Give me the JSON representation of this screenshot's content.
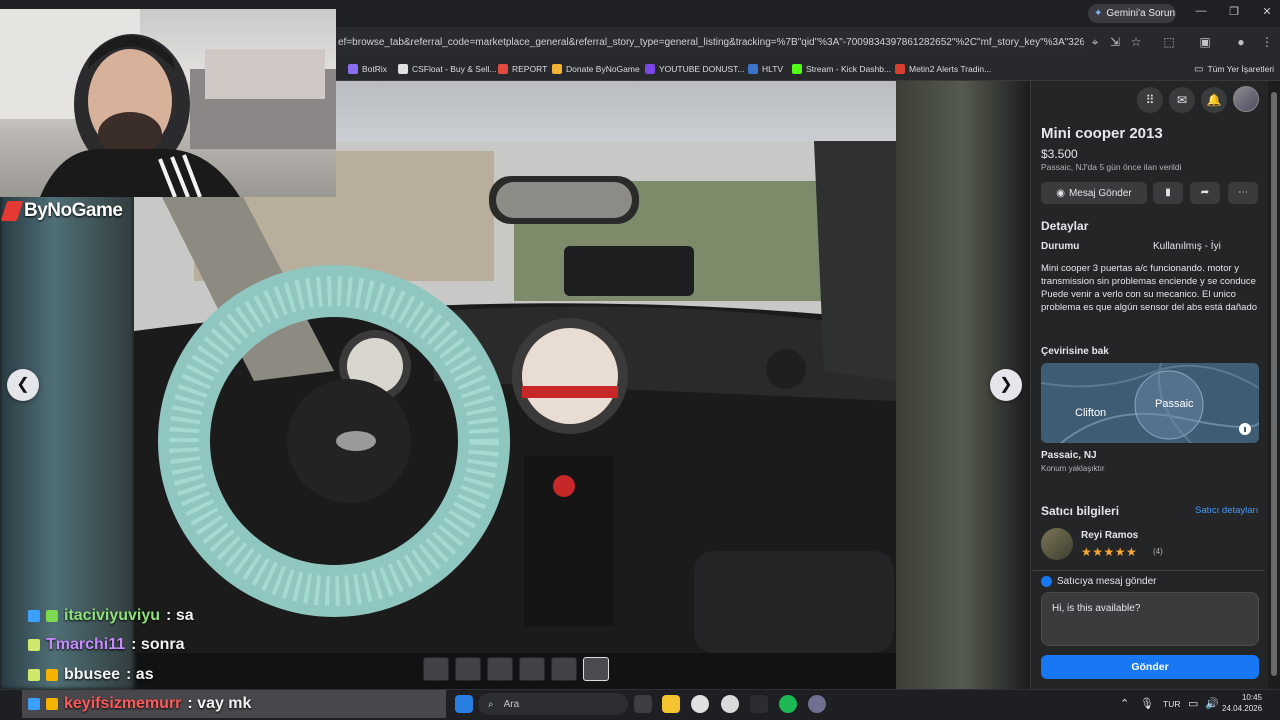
{
  "browser": {
    "gemini_label": "Gemini'a Sorun",
    "url": "ef=browse_tab&referral_code=marketplace_general&referral_story_type=general_listing&tracking=%7B\"qid\"%3A\"-7009834397861282652\"%2C\"mf_story_key\"%3A\"326799597417...",
    "window_controls": [
      "—",
      "❐",
      "✕"
    ],
    "bookmarks": [
      {
        "label": "BotRix",
        "color": "#8a6df0"
      },
      {
        "label": "CSFloat - Buy & Sell...",
        "color": "#e0e0e0"
      },
      {
        "label": "REPORT",
        "color": "#e04a3f"
      },
      {
        "label": "Donate ByNoGame",
        "color": "#f2b233"
      },
      {
        "label": "YOUTUBE DONUST...",
        "color": "#7b46e6"
      },
      {
        "label": "HLTV",
        "color": "#3b74c9"
      },
      {
        "label": "Stream - Kick Dashb...",
        "color": "#53fc18"
      },
      {
        "label": "Metin2 Alerts Tradin...",
        "color": "#d6402f"
      }
    ],
    "all_bookmarks": "Tüm Yer İşaretleri"
  },
  "overlay": {
    "brand": "ByNoGame",
    "chat": [
      {
        "user": "itaciviyuviyu",
        "msg": ": sa",
        "color": "#8ee07a"
      },
      {
        "user": "Tmarchi11",
        "msg": ": sonra",
        "color": "#c78bff"
      },
      {
        "user": "bbusee",
        "msg": ": as",
        "color": "#f5f5f5"
      }
    ],
    "last_chat": {
      "user": "keyifsizmemurr",
      "msg": ": vay mk",
      "color": "#ff5a5a"
    }
  },
  "listing": {
    "title": "Mini cooper 2013",
    "price": "$3.500",
    "posted": "Passaic, NJ'da 5 gün önce ilan verildi",
    "message_button": "Mesaj Gönder",
    "details_heading": "Detaylar",
    "condition_key": "Durumu",
    "condition_value": "Kullanılmış - İyi",
    "description": "Mini cooper 3 puertas  a/c funcionando. motor  y transmission sin problemas  enciende y se conduce\nPuede venir a verlo con su mecanico. El unico problema es que algún sensor del abs está dañado",
    "map_heading": "Çevirisine bak",
    "map_labels": {
      "left": "Clifton",
      "right": "Passaic"
    },
    "location": "Passaic, NJ",
    "location_note": "Konum yaklaşıktır",
    "seller_heading": "Satıcı bilgileri",
    "seller_link": "Satıcı detayları",
    "seller_name": "Reyi Ramos",
    "seller_rating": 5,
    "seller_rating_count": "(4)",
    "send_heading": "Satıcıya mesaj gönder",
    "send_message": "Hi, is this available?",
    "send_button": "Gönder"
  },
  "taskbar": {
    "search_placeholder": "Ara",
    "lang": "TUR",
    "time": "10:45",
    "date": "24.04.2026"
  },
  "colors": {
    "fb_blue": "#1877f2",
    "panel_bg": "#242526",
    "link": "#4599ff",
    "star": "#f7a631"
  }
}
